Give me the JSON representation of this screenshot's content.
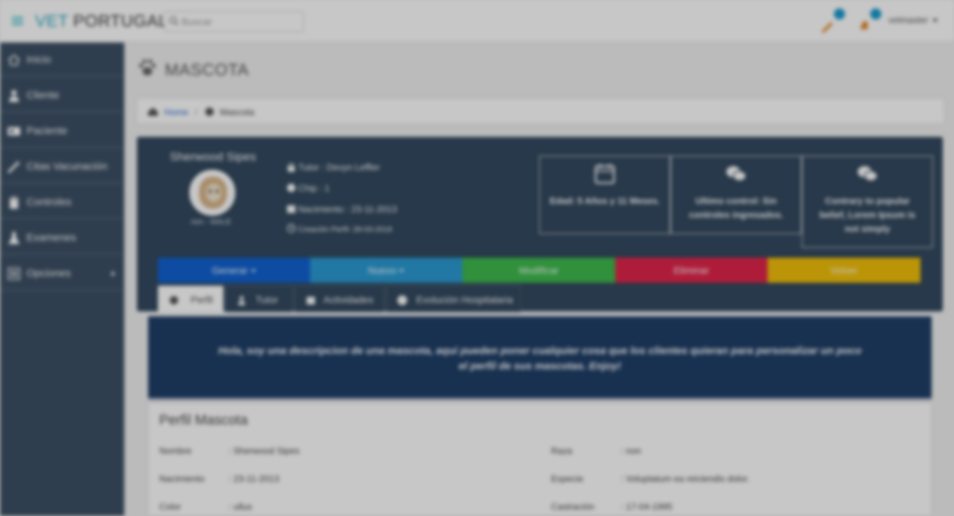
{
  "brand": {
    "part1": "VET",
    "part2": "PORTUGAL"
  },
  "search": {
    "placeholder": "Buscar"
  },
  "user": {
    "name": "vetmaster"
  },
  "sidebar": {
    "items": [
      {
        "label": "Inicio",
        "icon": "home-icon"
      },
      {
        "label": "Cliente",
        "icon": "user-icon"
      },
      {
        "label": "Paciente",
        "icon": "id-card-icon"
      },
      {
        "label": "Citas Vacunación",
        "icon": "syringe-icon"
      },
      {
        "label": "Controles",
        "icon": "clipboard-icon"
      },
      {
        "label": "Examenes",
        "icon": "flask-icon"
      },
      {
        "label": "Opciones",
        "icon": "list-icon"
      }
    ]
  },
  "page": {
    "title": "MASCOTA"
  },
  "breadcrumb": {
    "home": "Home",
    "separator": "/",
    "current": "Mascota"
  },
  "pet": {
    "name": "Sherwood Sipes",
    "subtitle": "non - MALE",
    "tutor": "Tutor : Devyn Leffler",
    "chip": "Chip : 1",
    "birth": "Nacimiento : 23-11-2013",
    "created": "Creación Perfil: 28-03-2019"
  },
  "stats": [
    {
      "text": "Edad: 5 Años y 11 Meses.",
      "icon": "calendar-icon"
    },
    {
      "text": "Ultimo control: Sin controles ingresados.",
      "icon": "chat-icon"
    },
    {
      "text": "Contrary to popular belief, Lorem Ipsum is not simply",
      "icon": "chat-icon"
    }
  ],
  "actions": {
    "generar": "Generar",
    "nuevo": "Nuevo",
    "modificar": "Modificar",
    "eliminar": "Eliminar",
    "volver": "Volver"
  },
  "tabs": [
    {
      "label": "Perfil",
      "icon": "paw-icon"
    },
    {
      "label": "Tutor",
      "icon": "user-icon"
    },
    {
      "label": "Actividades",
      "icon": "calendar-icon"
    },
    {
      "label": "Evolución Hospitalaria",
      "icon": "globe-icon"
    }
  ],
  "description": "Hola, soy una descripcion de una mascota, aqui pueden poner cualquier cosa que los clientes quieran para personalizar un poco el perfil de sus mascotas. Enjoy!",
  "profile": {
    "title": "Perfil Mascota",
    "fields": [
      {
        "label": "Nombre",
        "value": ": Sherwood Sipes"
      },
      {
        "label": "Nacimiento",
        "value": ": 23-11-2013"
      },
      {
        "label": "Color",
        "value": ": ullus"
      },
      {
        "label": "Raza",
        "value": ": non"
      },
      {
        "label": "Especie",
        "value": ": Voluptatum ea reiciendis dolor."
      },
      {
        "label": "Castración",
        "value": ": 17-04-1995"
      }
    ]
  },
  "colors": {
    "generar": "#1162d0",
    "nuevo": "#2b9ad2",
    "modificar": "#3eb94d",
    "eliminar": "#e0254a",
    "volver": "#f0bf0a",
    "sidebar": "#3d5065",
    "card": "#33495f",
    "description": "#1f3f67"
  }
}
